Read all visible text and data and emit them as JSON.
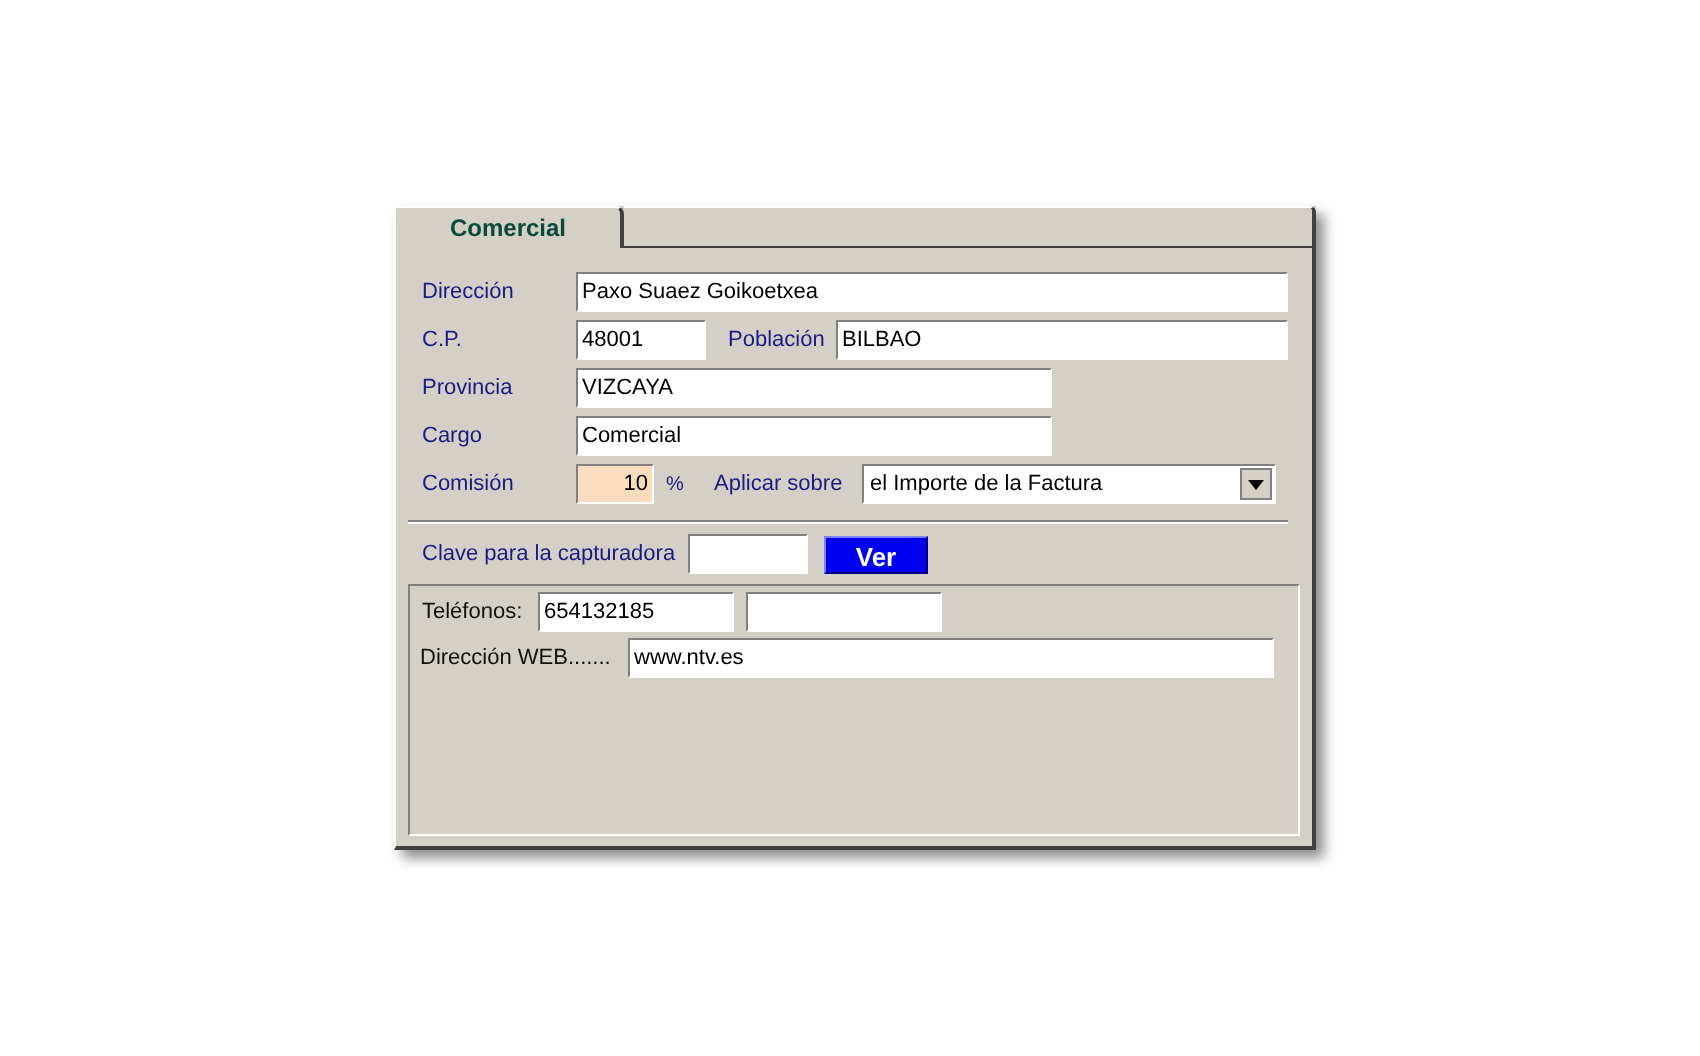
{
  "tabs": [
    {
      "label": "Comercial",
      "selected": true
    }
  ],
  "direccion": {
    "label": "Dirección",
    "value": "Paxo Suaez Goikoetxea"
  },
  "cp": {
    "label": "C.P.",
    "value": "48001"
  },
  "poblacion": {
    "label": "Población",
    "value": "BILBAO"
  },
  "provincia": {
    "label": "Provincia",
    "value": "VIZCAYA"
  },
  "cargo": {
    "label": "Cargo",
    "value": "Comercial"
  },
  "comision": {
    "label": "Comisión",
    "value": "10",
    "unit": "%"
  },
  "aplicar": {
    "label": "Aplicar sobre",
    "value": "el Importe de la Factura"
  },
  "clave": {
    "label": "Clave para la capturadora",
    "button": "Ver"
  },
  "telefonos": {
    "label": "Teléfonos:",
    "fields": [
      {
        "kind": "phone",
        "value": "654132185"
      },
      {
        "kind": "phone"
      }
    ]
  },
  "web": {
    "label": "Dirección WEB.......",
    "value": "www.ntv.es"
  }
}
